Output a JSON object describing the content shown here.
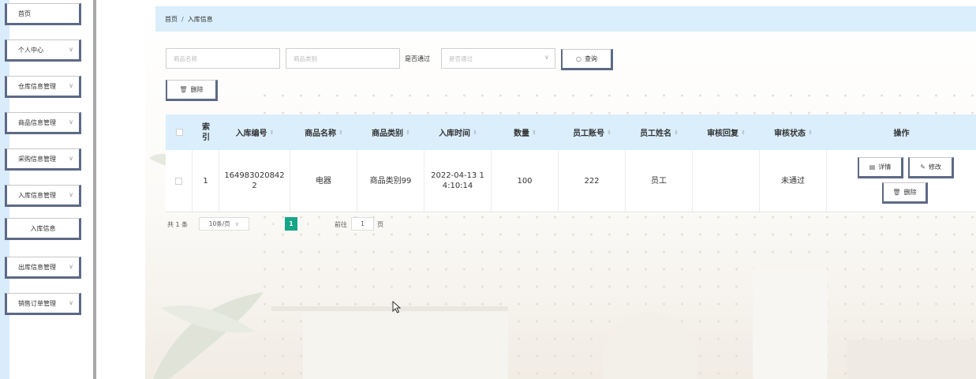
{
  "sidebar": {
    "items": [
      {
        "label": "首页",
        "chevron": ""
      },
      {
        "label": "个人中心",
        "chevron": "∨"
      },
      {
        "label": "仓库信息管理",
        "chevron": "∨"
      },
      {
        "label": "商品信息管理",
        "chevron": "∨"
      },
      {
        "label": "采购信息管理",
        "chevron": "∨"
      },
      {
        "label": "入库信息管理",
        "chevron": "∨"
      },
      {
        "label": "入库信息",
        "chevron": ""
      },
      {
        "label": "出库信息管理",
        "chevron": "∨"
      },
      {
        "label": "销售订单管理",
        "chevron": "∨"
      }
    ]
  },
  "breadcrumb": {
    "home": "首页",
    "sep": "/",
    "current": "入库信息"
  },
  "filters": {
    "name_placeholder": "商品名称",
    "category_placeholder": "商品类别",
    "approved_label": "是否通过",
    "approved_placeholder": "是否通过",
    "search_label": "查询"
  },
  "toolbar": {
    "delete_label": "删除"
  },
  "table": {
    "headers": [
      "索引",
      "入库编号",
      "商品名称",
      "商品类别",
      "入库时间",
      "数量",
      "员工账号",
      "员工姓名",
      "审核回复",
      "审核状态",
      "操作"
    ],
    "rows": [
      {
        "index": "1",
        "code": "164983020842 2",
        "name": "电器",
        "category": "商品类别99",
        "time": "2022-04-13 1 4:10:14",
        "qty": "100",
        "account": "222",
        "staff": "员工",
        "reply": "",
        "status": "未通过",
        "actions": {
          "detail": "详情",
          "edit": "修改",
          "delete": "删除"
        }
      }
    ]
  },
  "pagination": {
    "total": "共 1 条",
    "page_size": "10条/页",
    "current": "1",
    "goto_label": "前往",
    "goto_value": "1",
    "page_suffix": "页"
  },
  "colors": {
    "accent": "#daeefc",
    "active_page": "#17a589",
    "button_border": "#5d6a86"
  }
}
